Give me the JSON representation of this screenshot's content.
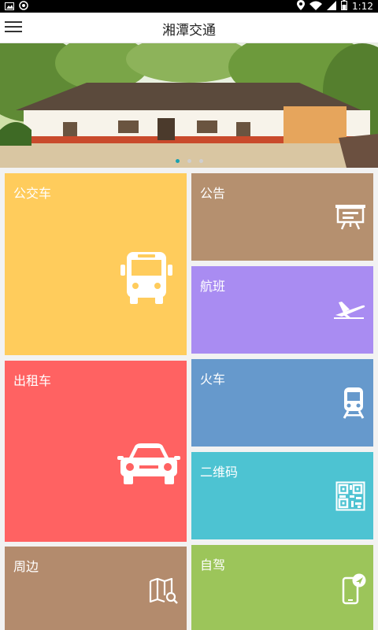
{
  "status_bar": {
    "time": "1:12"
  },
  "header": {
    "title": "湘潭交通"
  },
  "banner": {
    "slide_count": 3,
    "active_slide": 1
  },
  "tiles": [
    {
      "label": "公交车",
      "color": "#FFCC5C",
      "icon": "bus-icon"
    },
    {
      "label": "公告",
      "color": "#B5906F",
      "icon": "notice-board-icon"
    },
    {
      "label": "航班",
      "color": "#A98CF2",
      "icon": "airplane-icon"
    },
    {
      "label": "出租车",
      "color": "#FF6262",
      "icon": "taxi-icon"
    },
    {
      "label": "火车",
      "color": "#6699CC",
      "icon": "train-icon"
    },
    {
      "label": "二维码",
      "color": "#4DC3D2",
      "icon": "qr-code-icon"
    },
    {
      "label": "周边",
      "color": "#B38B6D",
      "icon": "map-search-icon"
    },
    {
      "label": "自驾",
      "color": "#9CC55A",
      "icon": "phone-navigation-icon"
    }
  ]
}
